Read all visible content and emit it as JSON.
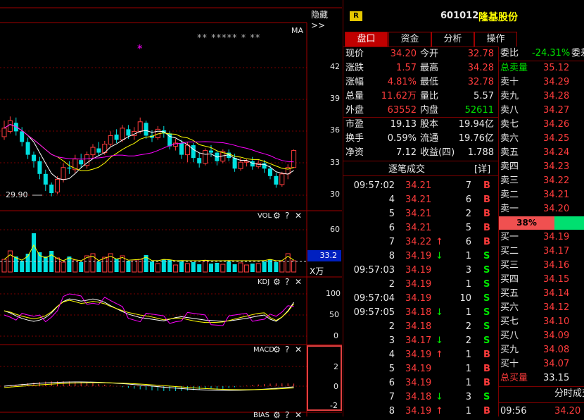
{
  "header": {
    "hide_label": "隐藏>>",
    "badge": "R",
    "stock_code": "601012",
    "stock_name": "隆基股份"
  },
  "kline": {
    "indicator_label": "MA",
    "stars_text": "** ***** *  **",
    "magenta_star": "*",
    "y_ticks": [
      "42",
      "39",
      "36",
      "33",
      "30"
    ],
    "low_label": "29.90"
  },
  "vol": {
    "label": "VOL",
    "y_ticks": [
      "60"
    ],
    "current_value": "33.2",
    "unit": "X万"
  },
  "kdj": {
    "label": "KDJ",
    "y_ticks": [
      "100",
      "50",
      "0"
    ]
  },
  "macd": {
    "label": "MACD",
    "y_ticks": [
      "2",
      "0",
      "-2"
    ]
  },
  "bias": {
    "label": "BIAS"
  },
  "panel_icons": {
    "gear": "⚙",
    "help": "?",
    "close": "✕"
  },
  "tabs": [
    "盘口",
    "资金",
    "分析",
    "操作"
  ],
  "quote": [
    {
      "label": "现价",
      "value": "34.20",
      "label2": "今开",
      "value2": "32.78"
    },
    {
      "label": "涨跌",
      "value": "1.57",
      "label2": "最高",
      "value2": "34.28"
    },
    {
      "label": "涨幅",
      "value": "4.81%",
      "label2": "最低",
      "value2": "32.78"
    },
    {
      "label": "总量",
      "value": "11.62万",
      "label2": "量比",
      "value2": "5.57"
    },
    {
      "label": "外盘",
      "value": "63552",
      "label2": "内盘",
      "value2": "52611"
    }
  ],
  "fundamentals": [
    {
      "label": "市盈",
      "value": "19.13",
      "label2": "股本",
      "value2": "19.94亿"
    },
    {
      "label": "换手",
      "value": "0.59%",
      "label2": "流通",
      "value2": "19.76亿"
    },
    {
      "label": "净资",
      "value": "7.12",
      "label2": "收益(四)",
      "value2": "1.788"
    }
  ],
  "ticks_header": {
    "title": "逐笔成交",
    "detail": "[详]"
  },
  "ticks": [
    {
      "time": "09:57:02",
      "price": "34.21",
      "arrow": "",
      "vol": "7",
      "side": "B"
    },
    {
      "time": "4",
      "price": "34.21",
      "arrow": "",
      "vol": "6",
      "side": "B"
    },
    {
      "time": "5",
      "price": "34.21",
      "arrow": "",
      "vol": "2",
      "side": "B"
    },
    {
      "time": "6",
      "price": "34.21",
      "arrow": "",
      "vol": "5",
      "side": "B"
    },
    {
      "time": "7",
      "price": "34.22",
      "arrow": "↑",
      "vol": "6",
      "side": "B"
    },
    {
      "time": "8",
      "price": "34.19",
      "arrow": "↓",
      "vol": "1",
      "side": "S"
    },
    {
      "time": "09:57:03",
      "price": "34.19",
      "arrow": "",
      "vol": "3",
      "side": "S"
    },
    {
      "time": "2",
      "price": "34.19",
      "arrow": "",
      "vol": "1",
      "side": "S"
    },
    {
      "time": "09:57:04",
      "price": "34.19",
      "arrow": "",
      "vol": "10",
      "side": "S"
    },
    {
      "time": "09:57:05",
      "price": "34.18",
      "arrow": "↓",
      "vol": "1",
      "side": "S"
    },
    {
      "time": "2",
      "price": "34.18",
      "arrow": "",
      "vol": "2",
      "side": "S"
    },
    {
      "time": "3",
      "price": "34.17",
      "arrow": "↓",
      "vol": "2",
      "side": "S"
    },
    {
      "time": "4",
      "price": "34.19",
      "arrow": "↑",
      "vol": "1",
      "side": "B"
    },
    {
      "time": "5",
      "price": "34.19",
      "arrow": "",
      "vol": "1",
      "side": "B"
    },
    {
      "time": "6",
      "price": "34.19",
      "arrow": "",
      "vol": "1",
      "side": "B"
    },
    {
      "time": "7",
      "price": "34.18",
      "arrow": "↓",
      "vol": "3",
      "side": "S"
    },
    {
      "time": "8",
      "price": "34.19",
      "arrow": "↑",
      "vol": "1",
      "side": "B"
    }
  ],
  "orderbook": {
    "weibi_label": "委比",
    "weibi_value": "-24.31%",
    "weibi_label2": "委差",
    "total_sell_label": "总卖量",
    "total_sell_value": "35.12",
    "sells": [
      {
        "label": "卖十",
        "price": "34.29"
      },
      {
        "label": "卖九",
        "price": "34.28"
      },
      {
        "label": "卖八",
        "price": "34.27"
      },
      {
        "label": "卖七",
        "price": "34.26"
      },
      {
        "label": "卖六",
        "price": "34.25"
      },
      {
        "label": "卖五",
        "price": "34.24"
      },
      {
        "label": "卖四",
        "price": "34.23"
      },
      {
        "label": "卖三",
        "price": "34.22"
      },
      {
        "label": "卖二",
        "price": "34.21"
      },
      {
        "label": "卖一",
        "price": "34.20"
      }
    ],
    "ratio_label": "38%",
    "ratio": 0.38,
    "buys": [
      {
        "label": "买一",
        "price": "34.19"
      },
      {
        "label": "买二",
        "price": "34.17"
      },
      {
        "label": "买三",
        "price": "34.16"
      },
      {
        "label": "买四",
        "price": "34.15"
      },
      {
        "label": "买五",
        "price": "34.14"
      },
      {
        "label": "买六",
        "price": "34.12"
      },
      {
        "label": "买七",
        "price": "34.10"
      },
      {
        "label": "买八",
        "price": "34.09"
      },
      {
        "label": "买九",
        "price": "34.08"
      },
      {
        "label": "买十",
        "price": "34.07"
      }
    ],
    "total_buy_label": "总买量",
    "total_buy_value": "33.15",
    "minute_title": "分时成交",
    "minute_time": "09:56",
    "minute_price": "34.20"
  },
  "colors": {
    "up": "#ff3c3c",
    "down": "#00e0e0",
    "grid": "#7a0000",
    "accent": "#c00000"
  }
}
